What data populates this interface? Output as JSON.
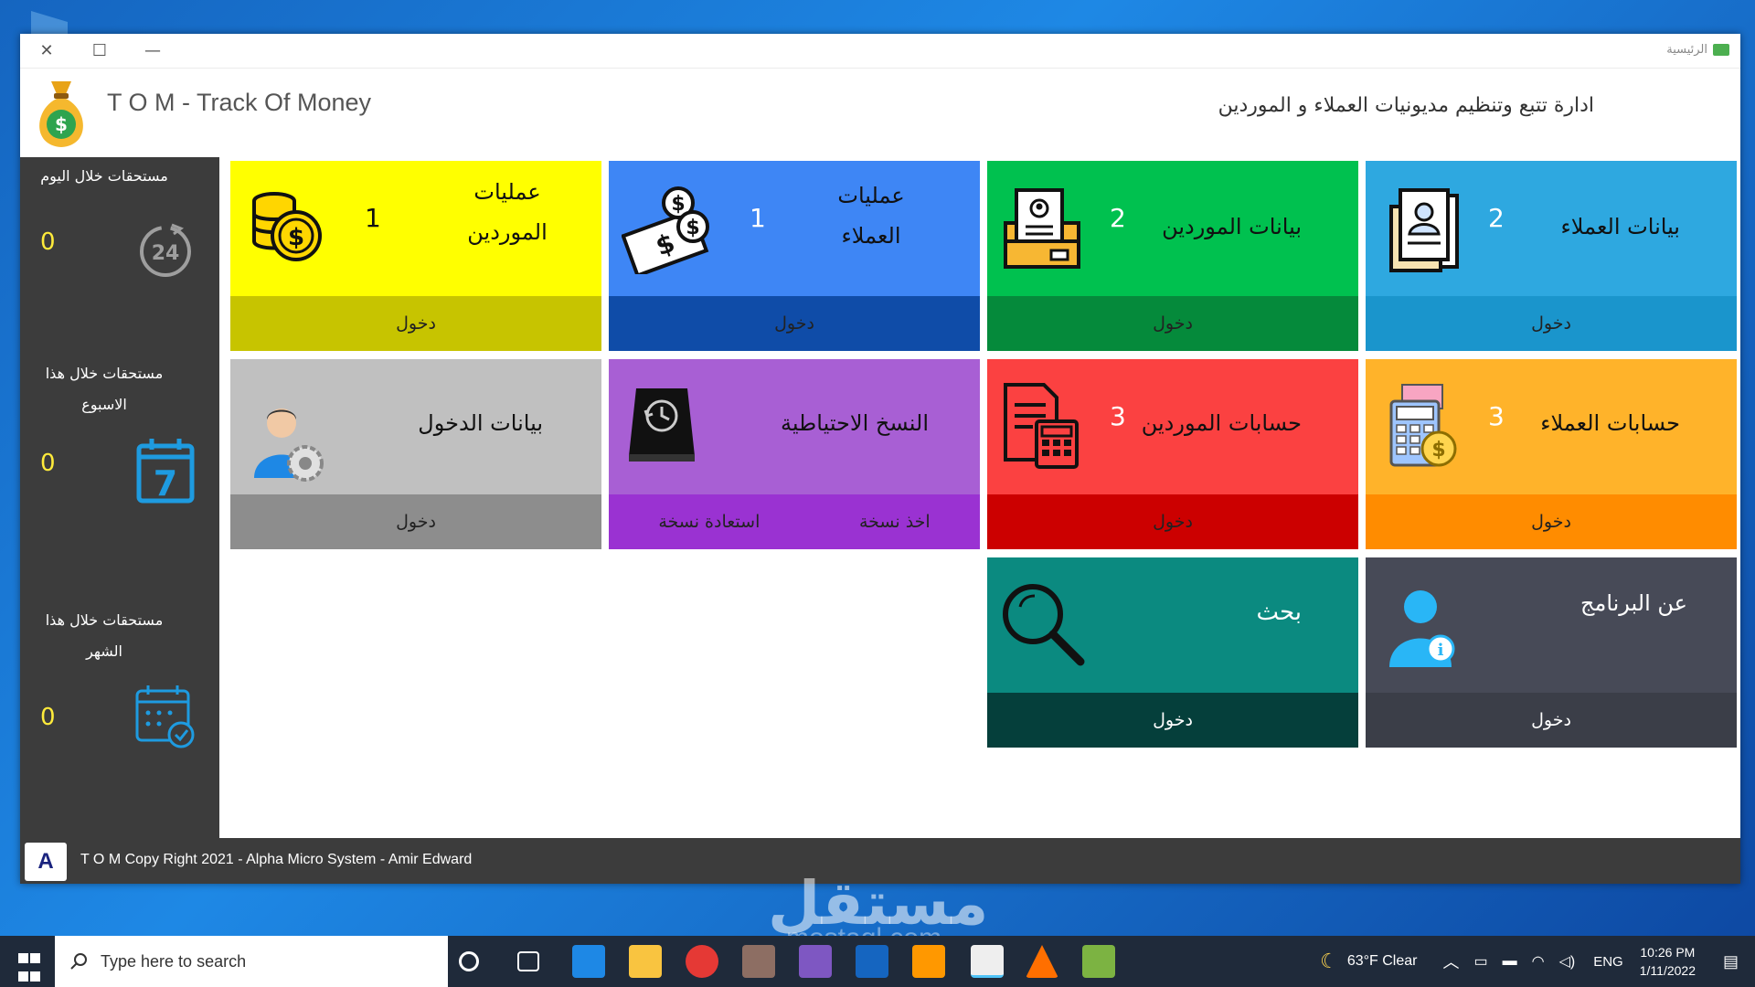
{
  "window": {
    "title": "الرئيسية",
    "app_name": "T O M - Track Of Money",
    "app_description": "ادارة تتبع وتنظيم مديونيات العملاء و الموردين",
    "close_glyph": "✕",
    "maximize_glyph": "☐",
    "minimize_glyph": "—"
  },
  "sidebar": {
    "blocks": [
      {
        "label": "مستحقات خلال اليوم",
        "count": "0",
        "icon": "clock-24-icon"
      },
      {
        "label": "مستحقات خلال هذا الاسبوع",
        "count": "0",
        "icon": "calendar-7-icon"
      },
      {
        "label": "مستحقات خلال هذا الشهر",
        "count": "0",
        "icon": "calendar-check-icon"
      }
    ]
  },
  "tiles": {
    "customers_data": {
      "title": "بيانات العملاء",
      "count": "2",
      "action": "دخول",
      "top_color": "#2ea8e0",
      "bottom_color": "#1a95cc"
    },
    "suppliers_data": {
      "title": "بيانات الموردين",
      "count": "2",
      "action": "دخول",
      "top_color": "#00c14f",
      "bottom_color": "#058a3b"
    },
    "customers_ops": {
      "title": "عمليات العملاء",
      "count": "1",
      "action": "دخول",
      "top_color": "#3e86f5",
      "bottom_color": "#0f4ca8"
    },
    "suppliers_ops": {
      "title": "عمليات الموردين",
      "count": "1",
      "action": "دخول",
      "top_color": "#ffff00",
      "bottom_color": "#c7c400"
    },
    "customers_accounts": {
      "title": "حسابات العملاء",
      "count": "3",
      "action": "دخول",
      "top_color": "#ffb32a",
      "bottom_color": "#ff8c00"
    },
    "suppliers_accounts": {
      "title": "حسابات الموردين",
      "count": "3",
      "action": "دخول",
      "top_color": "#fb4141",
      "bottom_color": "#cc0000"
    },
    "backup": {
      "title": "النسخ الاحتياطية",
      "action_take": "اخذ نسخة",
      "action_restore": "استعادة نسخة",
      "top_color": "#a85fd4",
      "bottom_color": "#9a32d2"
    },
    "login_data": {
      "title": "بيانات الدخول",
      "action": "دخول",
      "top_color": "#c0c0c0",
      "bottom_color": "#8d8d8d"
    },
    "about": {
      "title": "عن البرنامج",
      "action": "دخول",
      "top_color": "#474a57",
      "bottom_color": "#3b3e48"
    },
    "search": {
      "title": "بحث",
      "action": "دخول",
      "top_color": "#0b8a80",
      "bottom_color": "#053f3b"
    }
  },
  "footer": {
    "logo_letter": "A",
    "text": "T O M Copy Right 2021 - Alpha Micro System - Amir Edward"
  },
  "taskbar": {
    "search_placeholder": "Type here to search",
    "weather": "63°F  Clear",
    "language": "ENG",
    "time": "10:26 PM",
    "date": "1/11/2022"
  },
  "watermark": {
    "text": "مستقل",
    "subtext": "mostaql.com"
  }
}
